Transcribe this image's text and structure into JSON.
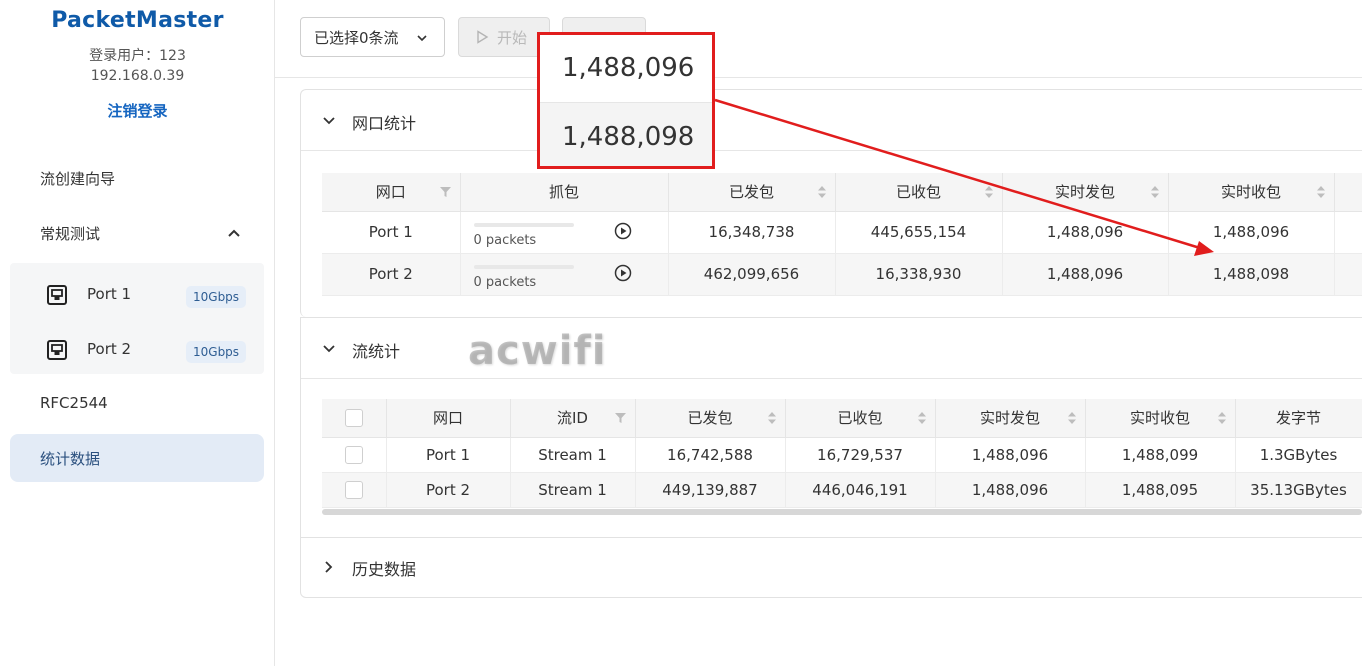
{
  "brand": "PacketMaster",
  "user": {
    "label": "登录用户：123",
    "ip": "192.168.0.39",
    "logout": "注销登录"
  },
  "nav": {
    "wizard": "流创建向导",
    "regular": "常规测试",
    "ports": [
      {
        "label": "Port 1",
        "speed": "10Gbps"
      },
      {
        "label": "Port 2",
        "speed": "10Gbps"
      }
    ],
    "rfc": "RFC2544",
    "stats": "统计数据"
  },
  "toolbar": {
    "select_streams": "已选择0条流",
    "start": "开始"
  },
  "port_stats": {
    "title": "网口统计",
    "headers": [
      "网口",
      "抓包",
      "已发包",
      "已收包",
      "实时发包",
      "实时收包"
    ],
    "rows": [
      {
        "port": "Port 1",
        "capture": "0 packets",
        "sent": "16,348,738",
        "recv": "445,655,154",
        "rt_sent": "1,488,096",
        "rt_recv": "1,488,096"
      },
      {
        "port": "Port 2",
        "capture": "0 packets",
        "sent": "462,099,656",
        "recv": "16,338,930",
        "rt_sent": "1,488,096",
        "rt_recv": "1,488,098"
      }
    ]
  },
  "stream_stats": {
    "title": "流统计",
    "headers": [
      "网口",
      "流ID",
      "已发包",
      "已收包",
      "实时发包",
      "实时收包",
      "发字节"
    ],
    "rows": [
      {
        "port": "Port 1",
        "id": "Stream 1",
        "sent": "16,742,588",
        "recv": "16,729,537",
        "rt_sent": "1,488,096",
        "rt_recv": "1,488,099",
        "bytes": "1.3GBytes"
      },
      {
        "port": "Port 2",
        "id": "Stream 1",
        "sent": "449,139,887",
        "recv": "446,046,191",
        "rt_sent": "1,488,096",
        "rt_recv": "1,488,095",
        "bytes": "35.13GBytes"
      }
    ]
  },
  "history": {
    "title": "历史数据"
  },
  "watermark": "acwifi",
  "callout": {
    "value1": "1,488,096",
    "value2": "1,488,098"
  },
  "colors": {
    "brand": "#0f5aa8",
    "accent": "#1565c0",
    "callout_border": "#e11d1d",
    "active_nav_bg": "#e3ebf6"
  }
}
